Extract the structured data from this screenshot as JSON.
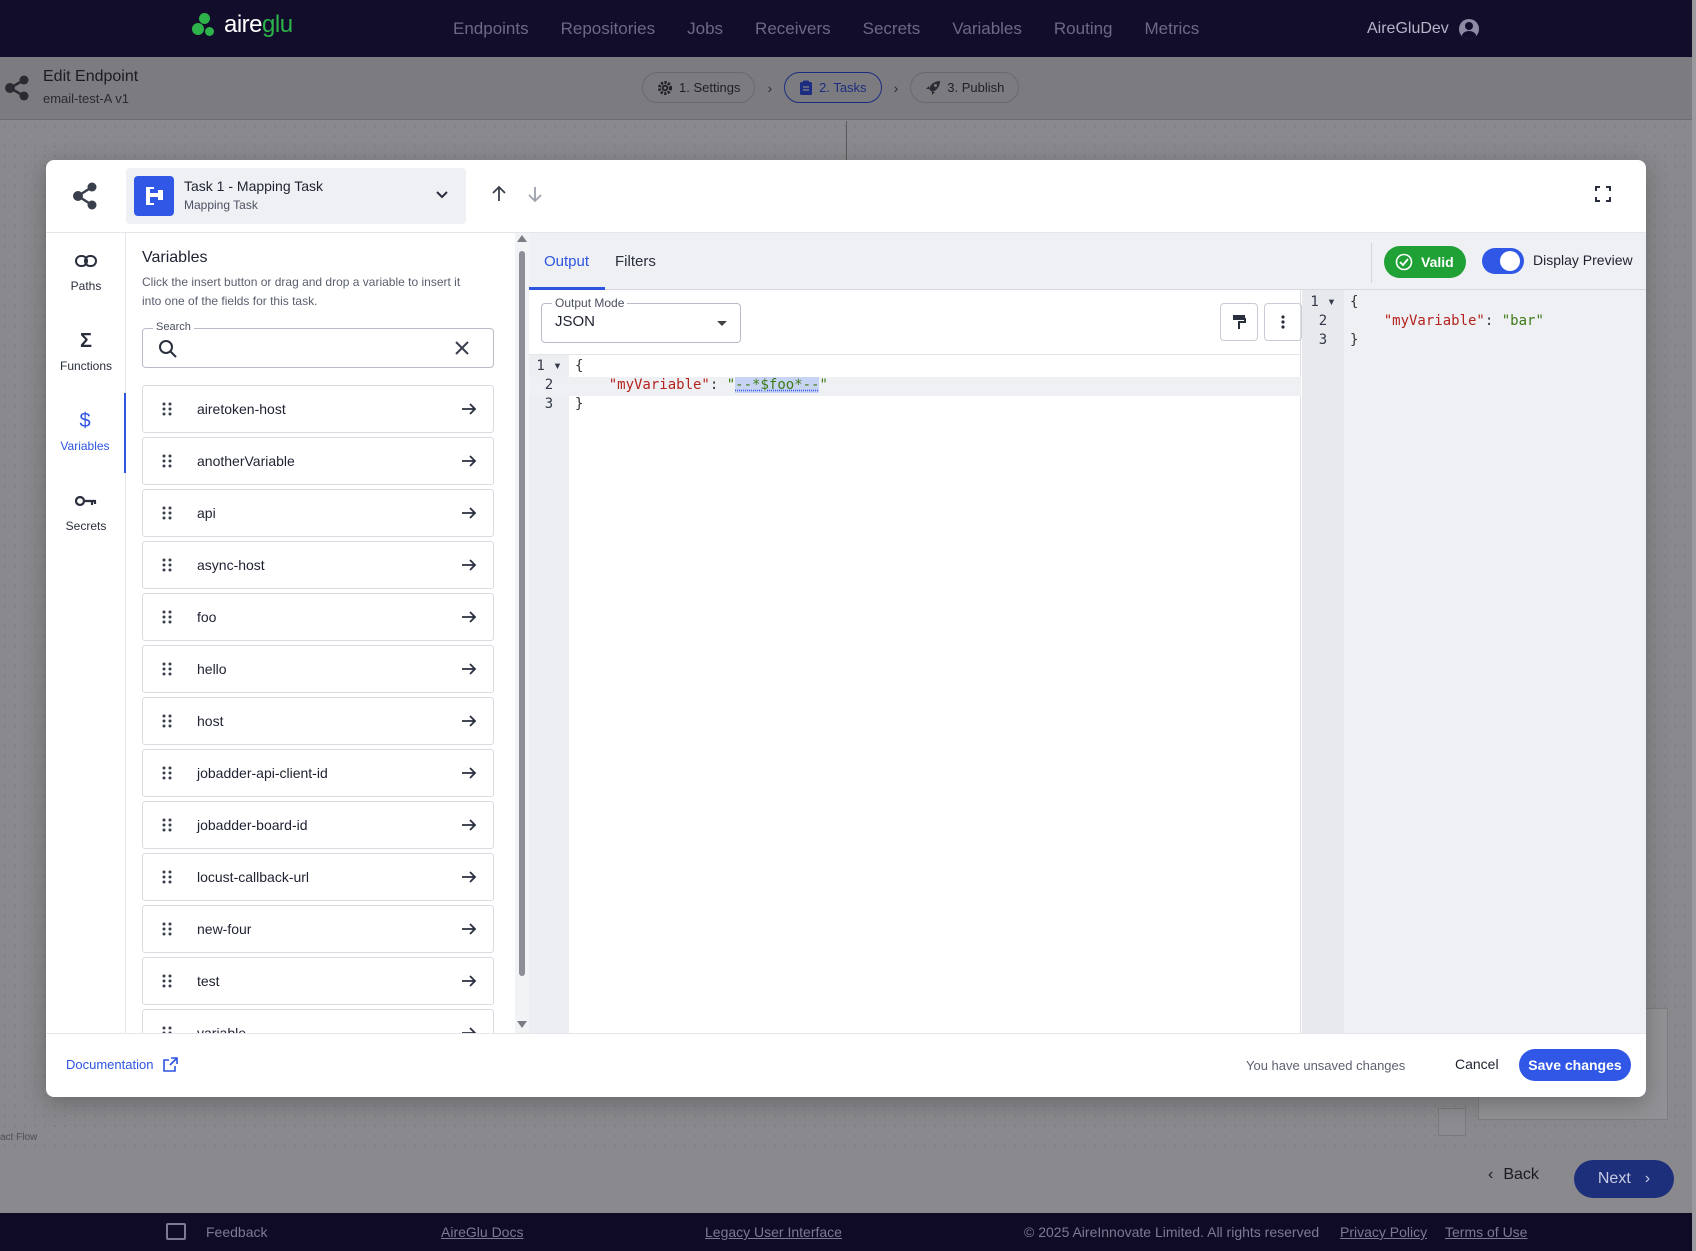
{
  "brand": {
    "name_a": "aire",
    "name_b": "glu"
  },
  "nav": {
    "links": [
      "Endpoints",
      "Repositories",
      "Jobs",
      "Receivers",
      "Secrets",
      "Variables",
      "Routing",
      "Metrics"
    ],
    "user": "AireGluDev"
  },
  "page": {
    "title": "Edit Endpoint",
    "subtitle": "email-test-A v1",
    "steps": [
      {
        "label": "1. Settings",
        "icon": "gear-icon",
        "active": false
      },
      {
        "label": "2. Tasks",
        "icon": "clipboard-icon",
        "active": true
      },
      {
        "label": "3. Publish",
        "icon": "rocket-icon",
        "active": false
      }
    ],
    "back_label": "Back",
    "next_label": "Next",
    "flow_label": "act Flow"
  },
  "modal": {
    "task_title": "Task 1 - Mapping Task",
    "task_subtitle": "Mapping Task",
    "rail": [
      {
        "label": "Paths",
        "icon": "link-icon",
        "active": false
      },
      {
        "label": "Functions",
        "icon": "sigma-icon",
        "active": false
      },
      {
        "label": "Variables",
        "icon": "dollar-icon",
        "active": true
      },
      {
        "label": "Secrets",
        "icon": "key-icon",
        "active": false
      }
    ],
    "variables": {
      "title": "Variables",
      "description": "Click the insert button or drag and drop a variable to insert it into one of the fields for this task.",
      "search_label": "Search",
      "search_value": "",
      "items": [
        "airetoken-host",
        "anotherVariable",
        "api",
        "async-host",
        "foo",
        "hello",
        "host",
        "jobadder-api-client-id",
        "jobadder-board-id",
        "locust-callback-url",
        "new-four",
        "test",
        "variable"
      ]
    },
    "tabs": [
      "Output",
      "Filters"
    ],
    "valid_label": "Valid",
    "preview_label": "Display Preview",
    "preview_on": true,
    "output_mode_label": "Output Mode",
    "output_mode_value": "JSON",
    "editor": {
      "line_numbers": [
        "1",
        "2",
        "3"
      ],
      "open": "{",
      "key": "\"myVariable\"",
      "colon": ": ",
      "quote_open": "\"",
      "value_selected": "--*$foo*--",
      "quote_close": "\"",
      "close": "}"
    },
    "preview": {
      "line_numbers": [
        "1",
        "2",
        "3"
      ],
      "open": "{",
      "key": "\"myVariable\"",
      "colon": ": ",
      "value": "\"bar\"",
      "close": "}"
    },
    "footer": {
      "documentation": "Documentation",
      "unsaved": "You have unsaved changes",
      "cancel": "Cancel",
      "save": "Save changes"
    }
  },
  "footer": {
    "feedback": "Feedback",
    "docs": "AireGlu Docs",
    "legacy": "Legacy User Interface",
    "copyright": "© 2025 AireInnovate Limited. All rights reserved",
    "privacy": "Privacy Policy",
    "terms": "Terms of Use"
  },
  "colors": {
    "accent": "#3057e6",
    "valid": "#20a135",
    "nav_bg": "#120d2a",
    "brand_green": "#2db34a",
    "json_key": "#b5231f",
    "json_string": "#3d7a14"
  }
}
